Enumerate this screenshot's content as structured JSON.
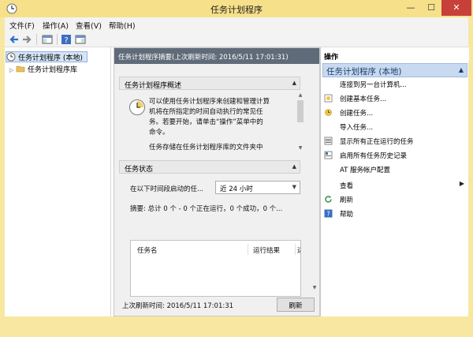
{
  "window": {
    "title": "任务计划程序",
    "min_glyph": "—",
    "max_glyph": "☐",
    "close_glyph": "✕"
  },
  "menu": {
    "items": [
      "文件(F)",
      "操作(A)",
      "查看(V)",
      "帮助(H)"
    ]
  },
  "toolbar": {
    "buttons": [
      "back-icon",
      "forward-icon",
      "console-tree-icon",
      "help-icon",
      "show-pane-icon"
    ]
  },
  "tree": {
    "root_label": "任务计划程序 (本地)",
    "child_label": "任务计划程序库",
    "expand_glyph": "▷"
  },
  "center": {
    "header": "任务计划程序摘要(上次刷新时间: 2016/5/11 17:01:31)",
    "overview_title": "任务计划程序概述",
    "overview_lines": [
      "可以使用任务计划程序来创建和管理计算",
      "机将在所指定的时间自动执行的常见任",
      "务。若要开始，请单击“操作”菜单中的",
      "命令。",
      "任务存储在任务计划程序库的文件夹中"
    ],
    "status_title": "任务状态",
    "status_filter_label": "在以下时间段启动的任...",
    "status_filter_value": "近 24 小时",
    "summary": "摘要: 总计 0 个 - 0 个正在运行，0 个成功，0 个...",
    "grid_headers": [
      "任务名",
      "运行结果",
      "运"
    ],
    "footer_text": "上次刷新时间: 2016/5/11 17:01:31",
    "refresh_button": "刷新",
    "collapse_glyph": "▲",
    "dropdown_glyph": "▼"
  },
  "actions": {
    "header": "操作",
    "group_label": "任务计划程序 (本地)",
    "group_glyph": "▲",
    "items": [
      {
        "label": "连接到另一台计算机...",
        "icon": ""
      },
      {
        "label": "创建基本任务...",
        "icon": "create-basic-task-icon"
      },
      {
        "label": "创建任务...",
        "icon": "create-task-icon"
      },
      {
        "label": "导入任务...",
        "icon": ""
      },
      {
        "label": "显示所有正在运行的任务",
        "icon": "running-tasks-icon"
      },
      {
        "label": "启用所有任务历史记录",
        "icon": "history-icon"
      },
      {
        "label": "AT 服务帐户配置",
        "icon": ""
      },
      {
        "label": "查看",
        "icon": ""
      },
      {
        "label": "刷新",
        "icon": "refresh-icon"
      },
      {
        "label": "帮助",
        "icon": "help-icon"
      }
    ],
    "submenu_glyph": "▶"
  },
  "colors": {
    "title_bar": "#f6e08a",
    "close_button": "#c7403a",
    "center_header": "#5f6b78",
    "action_group": "#c8daf0"
  }
}
